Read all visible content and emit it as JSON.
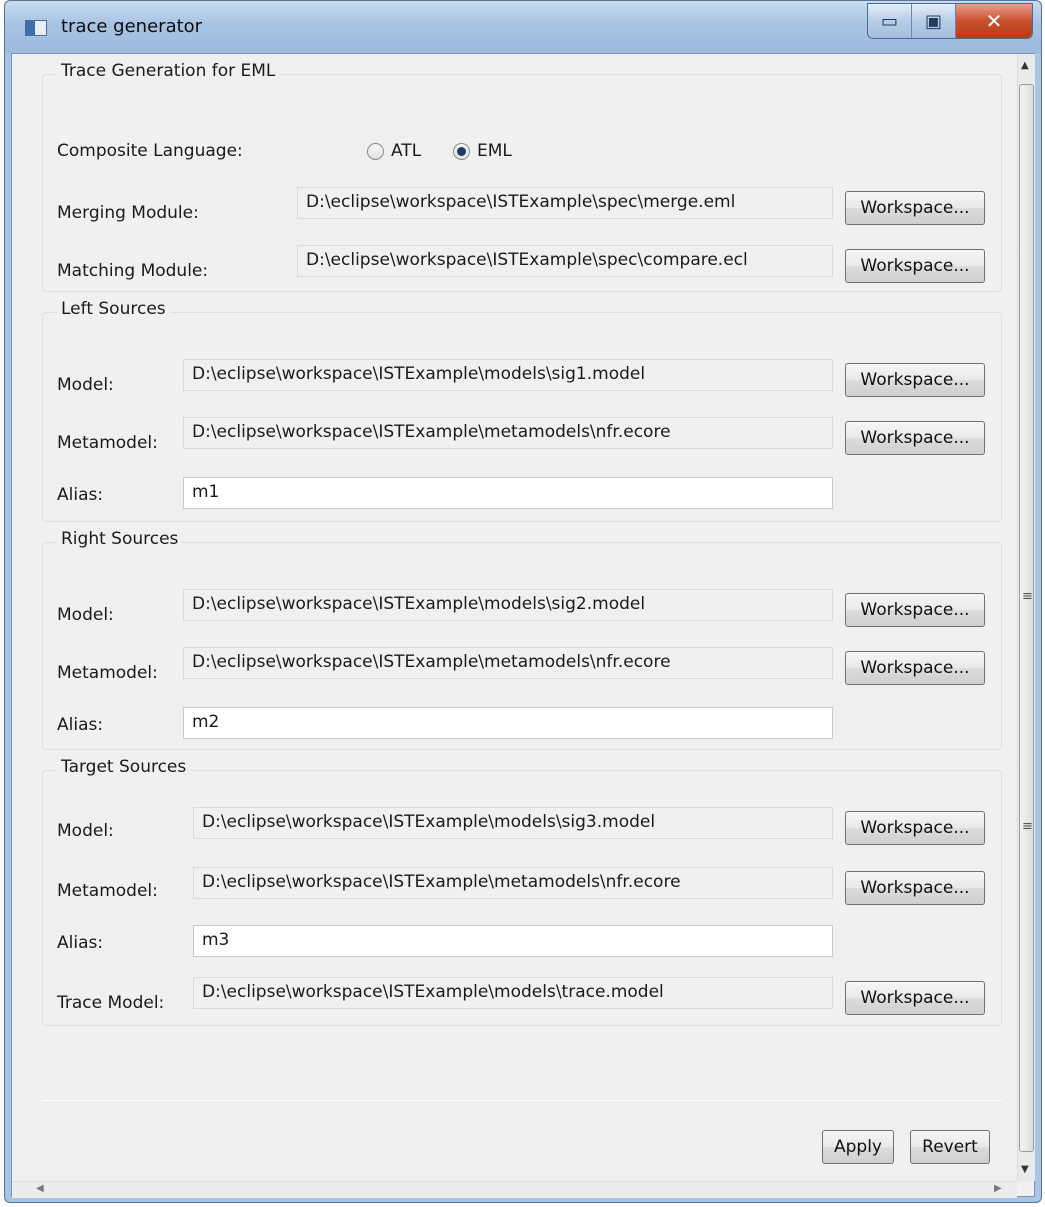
{
  "window": {
    "title": "trace generator",
    "minimize_glyph": "▭",
    "maximize_glyph": "▣",
    "close_glyph": "✕"
  },
  "trace_generation": {
    "heading": "Trace Generation for EML",
    "composite_language_label": "Composite Language:",
    "options": [
      {
        "label": "ATL",
        "selected": false
      },
      {
        "label": "EML",
        "selected": true
      }
    ],
    "merging_module_label": "Merging Module:",
    "merging_module_value": "D:\\eclipse\\workspace\\ISTExample\\spec\\merge.eml",
    "matching_module_label": "Matching Module:",
    "matching_module_value": "D:\\eclipse\\workspace\\ISTExample\\spec\\compare.ecl"
  },
  "left_sources": {
    "heading": "Left Sources",
    "model_label": "Model:",
    "model_value": "D:\\eclipse\\workspace\\ISTExample\\models\\sig1.model",
    "metamodel_label": "Metamodel:",
    "metamodel_value": "D:\\eclipse\\workspace\\ISTExample\\metamodels\\nfr.ecore",
    "alias_label": "Alias:",
    "alias_value": "m1"
  },
  "right_sources": {
    "heading": "Right Sources",
    "model_label": "Model:",
    "model_value": "D:\\eclipse\\workspace\\ISTExample\\models\\sig2.model",
    "metamodel_label": "Metamodel:",
    "metamodel_value": "D:\\eclipse\\workspace\\ISTExample\\metamodels\\nfr.ecore",
    "alias_label": "Alias:",
    "alias_value": "m2"
  },
  "target_sources": {
    "heading": "Target Sources",
    "model_label": "Model:",
    "model_value": "D:\\eclipse\\workspace\\ISTExample\\models\\sig3.model",
    "metamodel_label": "Metamodel:",
    "metamodel_value": "D:\\eclipse\\workspace\\ISTExample\\metamodels\\nfr.ecore",
    "alias_label": "Alias:",
    "alias_value": "m3",
    "trace_model_label": "Trace Model:",
    "trace_model_value": "D:\\eclipse\\workspace\\ISTExample\\models\\trace.model"
  },
  "workspace_button_label": "Workspace...",
  "footer": {
    "apply_label": "Apply",
    "revert_label": "Revert"
  },
  "scrollbar_glyphs": {
    "up": "▲",
    "down": "▼",
    "left": "◀",
    "right": "▶",
    "grip": "≡"
  }
}
